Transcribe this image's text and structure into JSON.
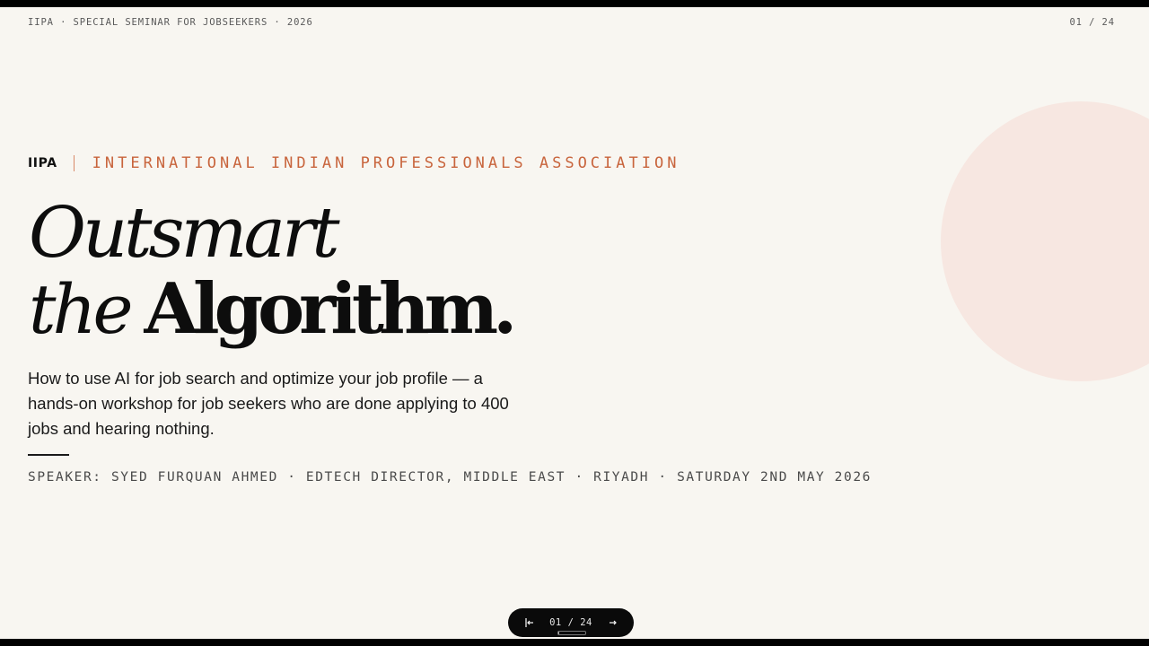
{
  "header": {
    "event_label": "IIPA · SPECIAL SEMINAR FOR JOBSEEKERS · 2026",
    "slide_counter": "01 / 24"
  },
  "org": {
    "abbr": "IIPA",
    "name": "INTERNATIONAL INDIAN PROFESSIONALS ASSOCIATION"
  },
  "title": {
    "line1": "Outsmart",
    "line2_italic": "the",
    "line2_bold": "Algorithm."
  },
  "description": "How to use AI for job search and optimize your job profile — a hands-on workshop for job seekers who are done applying to 400 jobs and hearing nothing.",
  "speaker": "SPEAKER: SYED FURQUAN AHMED · EDTECH DIRECTOR, MIDDLE EAST · RIYADH · SATURDAY 2ND MAY 2026",
  "navigation": {
    "prev_icon": "first-slide-icon",
    "next_icon": "arrow-right-icon",
    "counter": "01 / 24",
    "current": 1,
    "total": 24
  },
  "colors": {
    "background": "#f8f6f1",
    "accent": "#c8643c",
    "decor_circle": "#f7e7e1",
    "text": "#0d0d0d",
    "nav_background": "#0a0a0a"
  }
}
